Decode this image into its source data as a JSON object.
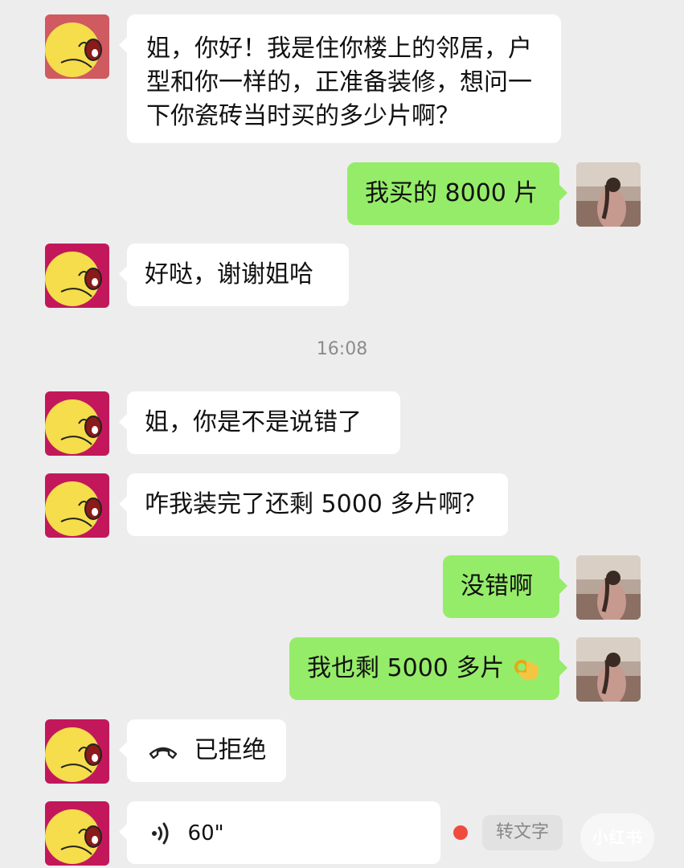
{
  "messages": [
    {
      "text": "姐，你好！我是住你楼上的邻居，户型和你一样的，正准备装修，想问一下你瓷砖当时买的多少片啊？"
    },
    {
      "text": "我买的 8000 片"
    },
    {
      "text": "好哒，谢谢姐哈"
    },
    {
      "text": "姐，你是不是说错了"
    },
    {
      "text": "咋我装完了还剩 5000 多片啊？"
    },
    {
      "text": "没错啊"
    },
    {
      "text": "我也剩 5000 多片"
    },
    {
      "text": "已拒绝",
      "icon": "phone-hangup-icon"
    },
    {
      "text": "60\"",
      "icon": "voice-wave-icon"
    }
  ],
  "timestamp": "16:08",
  "voice_to_text_label": "转文字",
  "watermark": "小红书",
  "colors": {
    "background": "#ededed",
    "incoming_bubble": "#ffffff",
    "outgoing_bubble": "#95ec69",
    "unread_dot": "#f04a3e"
  }
}
